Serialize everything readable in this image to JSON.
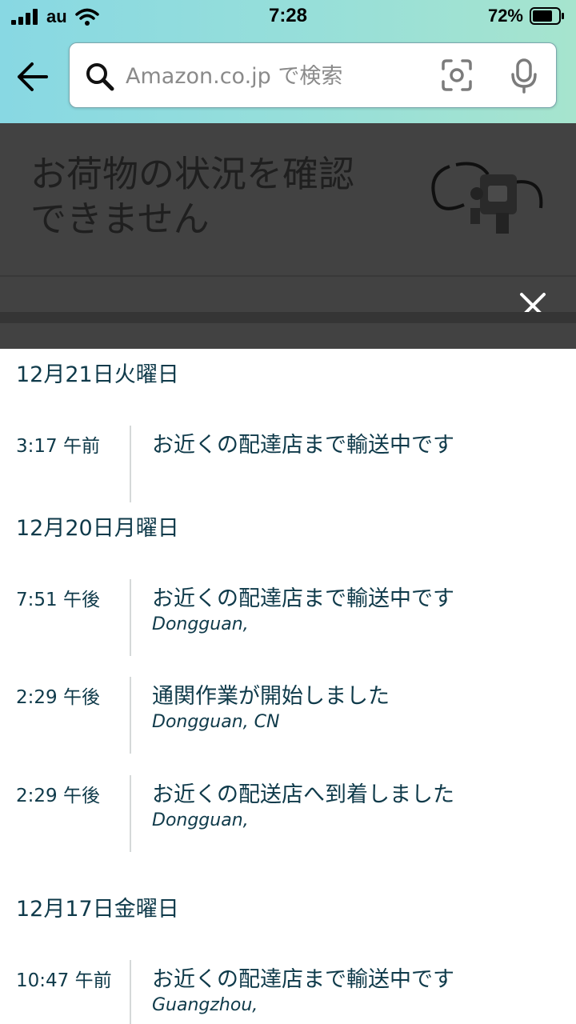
{
  "status_bar": {
    "carrier": "au",
    "time": "7:28",
    "battery": "72%"
  },
  "search": {
    "placeholder": "Amazon.co.jp で検索"
  },
  "banner": {
    "title_line1": "お荷物の状況を確認",
    "title_line2": "できません"
  },
  "icons": {
    "back": "back-arrow-icon",
    "search": "search-icon",
    "camera": "camera-scan-icon",
    "mic": "microphone-icon",
    "close": "close-icon",
    "signal": "signal-icon",
    "wifi": "wifi-icon",
    "battery": "battery-icon"
  },
  "tracking": [
    {
      "date": "12月21日火曜日",
      "events": [
        {
          "time": "3:17 午前",
          "desc": "お近くの配達店まで輸送中です",
          "location": ""
        }
      ]
    },
    {
      "date": "12月20日月曜日",
      "events": [
        {
          "time": "7:51 午後",
          "desc": "お近くの配達店まで輸送中です",
          "location": "Dongguan,"
        },
        {
          "time": "2:29 午後",
          "desc": "通関作業が開始しました",
          "location": "Dongguan, CN"
        },
        {
          "time": "2:29 午後",
          "desc": "お近くの配送店へ到着しました",
          "location": "Dongguan,"
        }
      ]
    },
    {
      "date": "12月17日金曜日",
      "events": [
        {
          "time": "10:47 午前",
          "desc": "お近くの配達店まで輸送中です",
          "location": "Guangzhou,"
        }
      ]
    }
  ]
}
